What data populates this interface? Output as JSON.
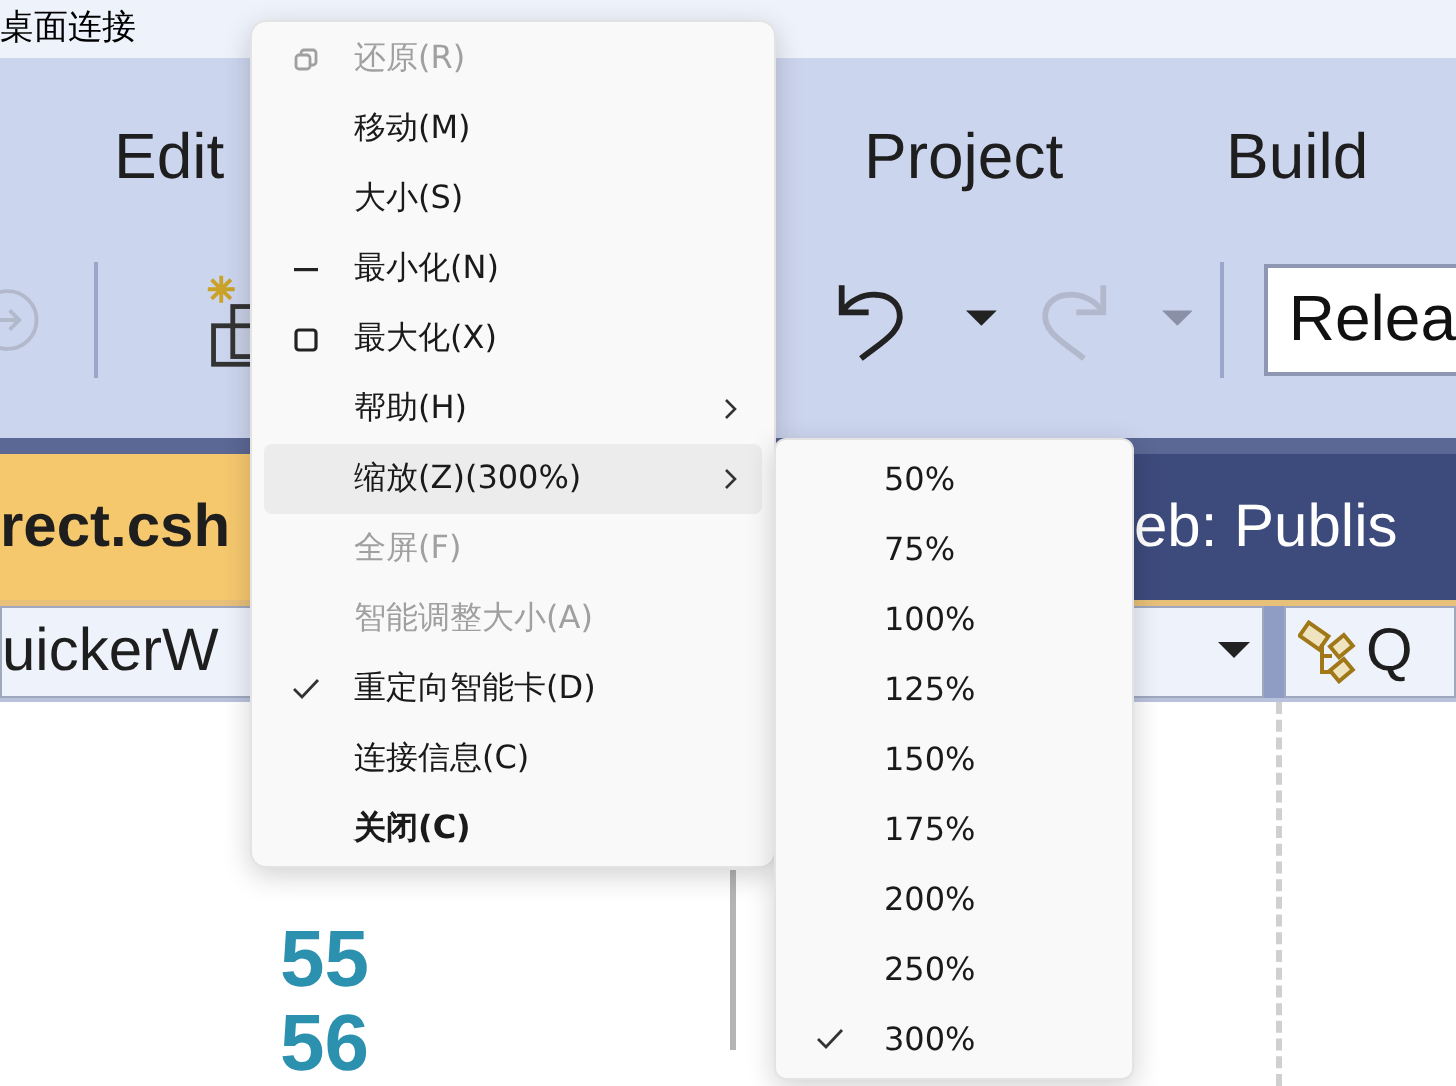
{
  "window": {
    "title": "桌面连接"
  },
  "menu_bar": [
    {
      "label": "Edit"
    },
    {
      "label": "Project"
    },
    {
      "label": "Build"
    }
  ],
  "toolbar": {
    "configuration": "Relea"
  },
  "document_tabs": [
    {
      "label": "rect.csh",
      "selected": true
    },
    {
      "label": "eb: Publis",
      "selected": false
    }
  ],
  "navigation_bar": {
    "scope": "uickerW",
    "member": "Q"
  },
  "editor": {
    "line_numbers": [
      "55",
      "56"
    ]
  },
  "system_menu": {
    "items": [
      {
        "label": "还原(R)",
        "kind": "restore",
        "disabled": true,
        "checked": false,
        "has_submenu": false,
        "selected": false,
        "default": false
      },
      {
        "label": "移动(M)",
        "kind": "plain",
        "disabled": false,
        "checked": false,
        "has_submenu": false,
        "selected": false,
        "default": false
      },
      {
        "label": "大小(S)",
        "kind": "plain",
        "disabled": false,
        "checked": false,
        "has_submenu": false,
        "selected": false,
        "default": false
      },
      {
        "label": "最小化(N)",
        "kind": "minimize",
        "disabled": false,
        "checked": false,
        "has_submenu": false,
        "selected": false,
        "default": false
      },
      {
        "label": "最大化(X)",
        "kind": "maximize",
        "disabled": false,
        "checked": false,
        "has_submenu": false,
        "selected": false,
        "default": false
      },
      {
        "label": "帮助(H)",
        "kind": "plain",
        "disabled": false,
        "checked": false,
        "has_submenu": true,
        "selected": false,
        "default": false
      },
      {
        "label": "缩放(Z)(300%)",
        "kind": "plain",
        "disabled": false,
        "checked": false,
        "has_submenu": true,
        "selected": true,
        "default": false
      },
      {
        "label": "全屏(F)",
        "kind": "plain",
        "disabled": true,
        "checked": false,
        "has_submenu": false,
        "selected": false,
        "default": false
      },
      {
        "label": "智能调整大小(A)",
        "kind": "plain",
        "disabled": true,
        "checked": false,
        "has_submenu": false,
        "selected": false,
        "default": false
      },
      {
        "label": "重定向智能卡(D)",
        "kind": "plain",
        "disabled": false,
        "checked": true,
        "has_submenu": false,
        "selected": false,
        "default": false
      },
      {
        "label": "连接信息(C)",
        "kind": "plain",
        "disabled": false,
        "checked": false,
        "has_submenu": false,
        "selected": false,
        "default": false
      },
      {
        "label": "关闭(C)",
        "kind": "plain",
        "disabled": false,
        "checked": false,
        "has_submenu": false,
        "selected": false,
        "default": true
      }
    ]
  },
  "zoom_submenu": {
    "items": [
      {
        "label": "50%",
        "checked": false
      },
      {
        "label": "75%",
        "checked": false
      },
      {
        "label": "100%",
        "checked": false
      },
      {
        "label": "125%",
        "checked": false
      },
      {
        "label": "150%",
        "checked": false
      },
      {
        "label": "175%",
        "checked": false
      },
      {
        "label": "200%",
        "checked": false
      },
      {
        "label": "250%",
        "checked": false
      },
      {
        "label": "300%",
        "checked": true
      }
    ]
  }
}
